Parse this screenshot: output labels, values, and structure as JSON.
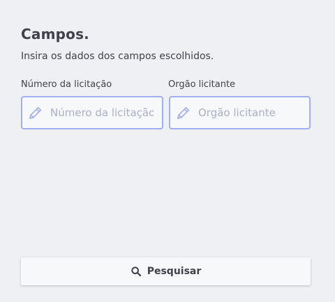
{
  "panel": {
    "title": "Campos.",
    "subtitle": "Insira os dados dos campos escolhidos."
  },
  "fields": [
    {
      "label": "Número da licitação",
      "placeholder": "Número da licitação",
      "value": "",
      "icon": "pencil-icon"
    },
    {
      "label": "Orgão licitante",
      "placeholder": "Orgão licitante",
      "value": "",
      "icon": "pencil-icon"
    }
  ],
  "search_button": {
    "label": "Pesquisar",
    "icon": "search-icon"
  },
  "colors": {
    "background": "#eef0f4",
    "field_border": "#a3aef0",
    "icon": "#a3aef0",
    "text": "#3f424a",
    "placeholder": "#aab0c6"
  }
}
